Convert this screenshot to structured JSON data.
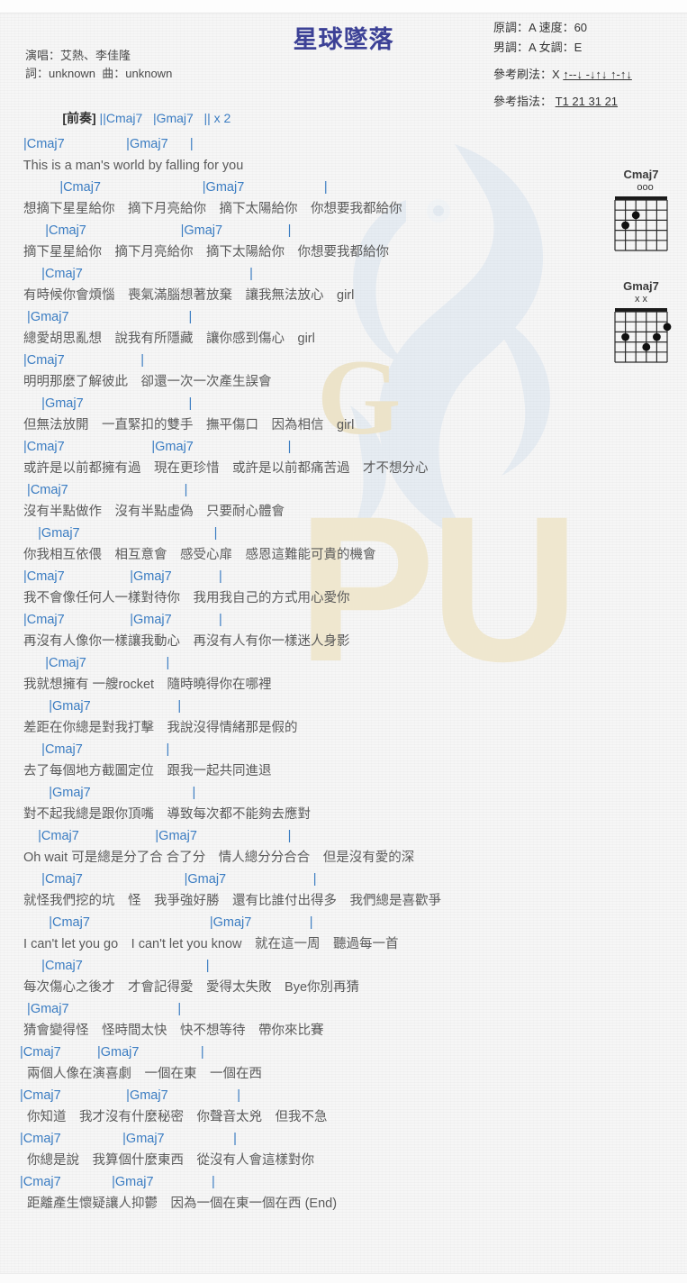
{
  "song": {
    "title": "星球墜落",
    "singer_line": "演唱：艾熱、李佳隆",
    "credit_line": "詞：unknown  曲：unknown"
  },
  "meta": {
    "line1": "原調：A  速度：60",
    "line2": "男調：A  女調：E",
    "strum_label": "參考刷法：X",
    "strum_pattern": "↑--↓ -↓↑↓ ↑-↑↓",
    "pick_label": "參考指法：",
    "pick_pattern": "T1 21 31 21"
  },
  "intro": {
    "label": "[前奏]",
    "text": " ||Cmaj7   |Gmaj7   || x 2"
  },
  "diagrams": [
    {
      "name": "Cmaj7",
      "marks": "   ooo",
      "dots": [
        [
          4,
          2
        ],
        [
          5,
          3
        ]
      ],
      "open": [
        1,
        2,
        3
      ],
      "muted": []
    },
    {
      "name": "Gmaj7",
      "marks": "x x",
      "dots": [
        [
          1,
          2
        ],
        [
          2,
          3
        ],
        [
          3,
          4
        ],
        [
          5,
          3
        ]
      ],
      "open": [],
      "muted": [
        6,
        5
      ]
    }
  ],
  "lines": [
    {
      "type": "chord",
      "text": " |Cmaj7                 |Gmaj7      |"
    },
    {
      "type": "lyric",
      "text": " This is a man's world by falling for you"
    },
    {
      "type": "chord",
      "text": "           |Cmaj7                            |Gmaj7                      |"
    },
    {
      "type": "lyric",
      "text": " 想摘下星星給你　摘下月亮給你　摘下太陽給你　你想要我都給你"
    },
    {
      "type": "chord",
      "text": "       |Cmaj7                          |Gmaj7                  |"
    },
    {
      "type": "lyric",
      "text": " 摘下星星給你　摘下月亮給你　摘下太陽給你　你想要我都給你"
    },
    {
      "type": "chord",
      "text": "      |Cmaj7                                              |"
    },
    {
      "type": "lyric",
      "text": " 有時候你會煩惱　喪氣滿腦想著放棄　讓我無法放心　girl"
    },
    {
      "type": "chord",
      "text": "  |Gmaj7                                 |"
    },
    {
      "type": "lyric",
      "text": " 總愛胡思亂想　說我有所隱藏　讓你感到傷心　girl"
    },
    {
      "type": "chord",
      "text": " |Cmaj7                     |"
    },
    {
      "type": "lyric",
      "text": " 明明那麼了解彼此　卻還一次一次產生誤會"
    },
    {
      "type": "chord",
      "text": "      |Gmaj7                             |"
    },
    {
      "type": "lyric",
      "text": " 但無法放開　一直緊扣的雙手　撫平傷口　因為相信　girl"
    },
    {
      "type": "chord",
      "text": " |Cmaj7                        |Gmaj7                          |"
    },
    {
      "type": "lyric",
      "text": " 或許是以前都擁有過　現在更珍惜　或許是以前都痛苦過　才不想分心"
    },
    {
      "type": "chord",
      "text": "  |Cmaj7                                |"
    },
    {
      "type": "lyric",
      "text": " 沒有半點做作　沒有半點虛偽　只要耐心體會"
    },
    {
      "type": "chord",
      "text": "     |Gmaj7                                     |"
    },
    {
      "type": "lyric",
      "text": " 你我相互依偎　相互意會　感受心扉　感恩這難能可貴的機會"
    },
    {
      "type": "chord",
      "text": " |Cmaj7                  |Gmaj7             |"
    },
    {
      "type": "lyric",
      "text": " 我不會像任何人一樣對待你　我用我自己的方式用心愛你"
    },
    {
      "type": "chord",
      "text": " |Cmaj7                  |Gmaj7             |"
    },
    {
      "type": "lyric",
      "text": " 再沒有人像你一樣讓我動心　再沒有人有你一樣迷人身影"
    },
    {
      "type": "chord",
      "text": "       |Cmaj7                      |"
    },
    {
      "type": "lyric",
      "text": " 我就想擁有 一艘rocket　隨時曉得你在哪裡"
    },
    {
      "type": "chord",
      "text": "        |Gmaj7                        |"
    },
    {
      "type": "lyric",
      "text": " 差距在你總是對我打擊　我說沒得情緒那是假的"
    },
    {
      "type": "chord",
      "text": "      |Cmaj7                       |"
    },
    {
      "type": "lyric",
      "text": " 去了每個地方截圖定位　跟我一起共同進退"
    },
    {
      "type": "chord",
      "text": "        |Gmaj7                            |"
    },
    {
      "type": "lyric",
      "text": " 對不起我總是跟你頂嘴　導致每次都不能夠去應對"
    },
    {
      "type": "chord",
      "text": "     |Cmaj7                     |Gmaj7                         |"
    },
    {
      "type": "lyric",
      "text": " Oh wait 可是總是分了合 合了分　情人總分分合合　但是沒有愛的深"
    },
    {
      "type": "chord",
      "text": "      |Cmaj7                            |Gmaj7                        |"
    },
    {
      "type": "lyric",
      "text": " 就怪我們挖的坑　怪　我爭強好勝　還有比誰付出得多　我們總是喜歡爭"
    },
    {
      "type": "chord",
      "text": "        |Cmaj7                                 |Gmaj7                |"
    },
    {
      "type": "lyric",
      "text": " I can't let you go　I can't let you know　就在這一周　聽過每一首"
    },
    {
      "type": "chord",
      "text": "      |Cmaj7                                  |"
    },
    {
      "type": "lyric",
      "text": " 每次傷心之後才　才會記得愛　愛得太失敗　Bye你別再猜"
    },
    {
      "type": "chord",
      "text": "  |Gmaj7                              |"
    },
    {
      "type": "lyric",
      "text": " 猜會變得怪　怪時間太快　快不想等待　帶你來比賽"
    },
    {
      "type": "chord",
      "text": "|Cmaj7          |Gmaj7                 |"
    },
    {
      "type": "lyric",
      "text": "  兩個人像在演喜劇　一個在東　一個在西"
    },
    {
      "type": "chord",
      "text": "|Cmaj7                  |Gmaj7                   |"
    },
    {
      "type": "lyric",
      "text": "  你知道　我才沒有什麼秘密　你聲音太兇　但我不急"
    },
    {
      "type": "chord",
      "text": "|Cmaj7                 |Gmaj7                   |"
    },
    {
      "type": "lyric",
      "text": "  你總是說　我算個什麼東西　從沒有人會這樣對你"
    },
    {
      "type": "chord",
      "text": "|Cmaj7              |Gmaj7                |"
    },
    {
      "type": "lyric",
      "text": "  距離產生懷疑讓人抑鬱　因為一個在東一個在西 (End)"
    }
  ],
  "watermark": {
    "text": "PU",
    "badge": "G",
    "color": "#efe7cf"
  },
  "colors": {
    "chord": "#3a7cc2",
    "lyric": "#5a5a5a",
    "title": "#3c4196",
    "bar": "#6a5a3a"
  }
}
